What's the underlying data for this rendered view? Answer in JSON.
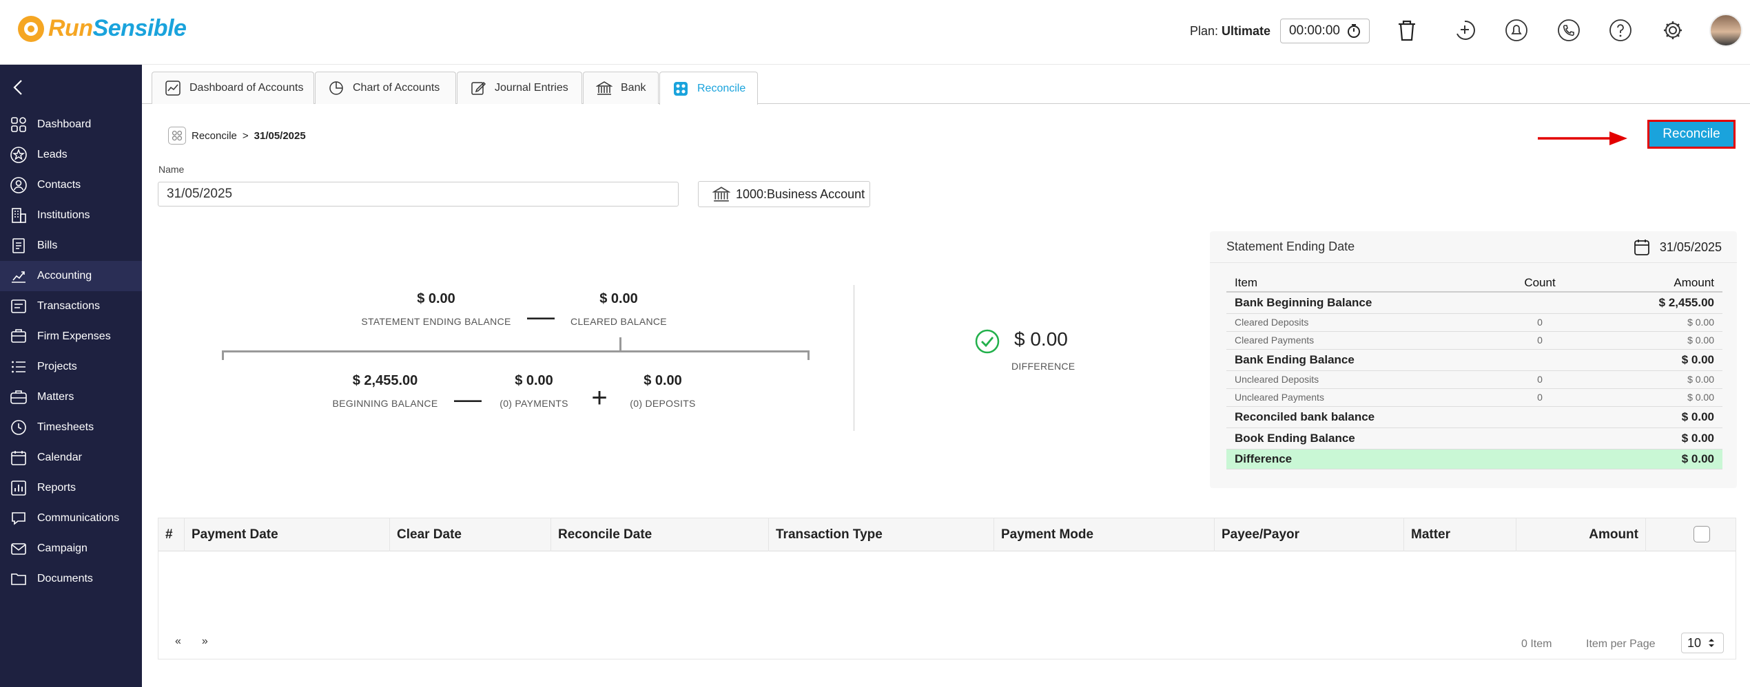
{
  "header": {
    "logo_run": "Run",
    "logo_sensible": "Sensible",
    "plan_label": "Plan:",
    "plan_value": "Ultimate",
    "timer": "00:00:00",
    "icons": [
      "trash-icon",
      "add-timer-icon",
      "notification-icon",
      "phone-icon",
      "help-icon",
      "settings-icon"
    ]
  },
  "sidebar": {
    "items": [
      {
        "label": "Dashboard",
        "icon": "dashboard-icon"
      },
      {
        "label": "Leads",
        "icon": "star-icon"
      },
      {
        "label": "Contacts",
        "icon": "contact-icon"
      },
      {
        "label": "Institutions",
        "icon": "building-icon"
      },
      {
        "label": "Bills",
        "icon": "bill-icon"
      },
      {
        "label": "Accounting",
        "icon": "chart-icon"
      },
      {
        "label": "Transactions",
        "icon": "transactions-icon"
      },
      {
        "label": "Firm Expenses",
        "icon": "expenses-icon"
      },
      {
        "label": "Projects",
        "icon": "list-icon"
      },
      {
        "label": "Matters",
        "icon": "briefcase-icon"
      },
      {
        "label": "Timesheets",
        "icon": "clock-icon"
      },
      {
        "label": "Calendar",
        "icon": "calendar-icon"
      },
      {
        "label": "Reports",
        "icon": "reports-icon"
      },
      {
        "label": "Communications",
        "icon": "chat-icon"
      },
      {
        "label": "Campaign",
        "icon": "mail-icon"
      },
      {
        "label": "Documents",
        "icon": "folder-icon"
      }
    ]
  },
  "tabs": [
    {
      "label": "Dashboard of Accounts"
    },
    {
      "label": "Chart of Accounts"
    },
    {
      "label": "Journal Entries"
    },
    {
      "label": "Bank"
    },
    {
      "label": "Reconcile"
    }
  ],
  "breadcrumb": {
    "root": "Reconcile",
    "separator": ">",
    "current": "31/05/2025"
  },
  "reconcile_button": "Reconcile",
  "form": {
    "name_label": "Name",
    "name_value": "31/05/2025",
    "account": "1000:Business Account"
  },
  "formula": {
    "statement_ending_balance": "$ 0.00",
    "statement_ending_balance_label": "STATEMENT ENDING BALANCE",
    "cleared_balance": "$ 0.00",
    "cleared_balance_label": "CLEARED BALANCE",
    "beginning_balance": "$ 2,455.00",
    "beginning_balance_label": "BEGINNING BALANCE",
    "payments": "$ 0.00",
    "payments_label": "(0) PAYMENTS",
    "deposits": "$ 0.00",
    "deposits_label": "(0) DEPOSITS",
    "minus": "—",
    "plus": "+",
    "difference": "$ 0.00",
    "difference_label": "DIFFERENCE"
  },
  "summary": {
    "title": "Statement Ending Date",
    "date": "31/05/2025",
    "columns": {
      "item": "Item",
      "count": "Count",
      "amount": "Amount"
    },
    "rows": [
      {
        "item": "Bank Beginning Balance",
        "count": "",
        "amount": "$ 2,455.00",
        "style": "big"
      },
      {
        "item": "Cleared Deposits",
        "count": "0",
        "amount": "$ 0.00",
        "style": "small"
      },
      {
        "item": "Cleared Payments",
        "count": "0",
        "amount": "$ 0.00",
        "style": "small"
      },
      {
        "item": "Bank Ending Balance",
        "count": "",
        "amount": "$ 0.00",
        "style": "big"
      },
      {
        "item": "Uncleared Deposits",
        "count": "0",
        "amount": "$ 0.00",
        "style": "small"
      },
      {
        "item": "Uncleared Payments",
        "count": "0",
        "amount": "$ 0.00",
        "style": "small"
      },
      {
        "item": "Reconciled bank balance",
        "count": "",
        "amount": "$ 0.00",
        "style": "big"
      },
      {
        "item": "Book Ending Balance",
        "count": "",
        "amount": "$ 0.00",
        "style": "big"
      },
      {
        "item": "Difference",
        "count": "",
        "amount": "$ 0.00",
        "style": "diff"
      }
    ]
  },
  "table": {
    "columns": [
      "#",
      "Payment Date",
      "Clear Date",
      "Reconcile Date",
      "Transaction Type",
      "Payment Mode",
      "Payee/Payor",
      "Matter",
      "Amount"
    ],
    "rows": [],
    "pager_prev": "«",
    "pager_next": "»",
    "item_count": "0 Item",
    "items_per_page_label": "Item per Page",
    "items_per_page": "10"
  },
  "colors": {
    "accent": "#1aa3dc",
    "brand_orange": "#f5a623",
    "sidebar": "#1e2140",
    "highlight": "#e30000",
    "difference_bg": "#c9f7d5"
  }
}
